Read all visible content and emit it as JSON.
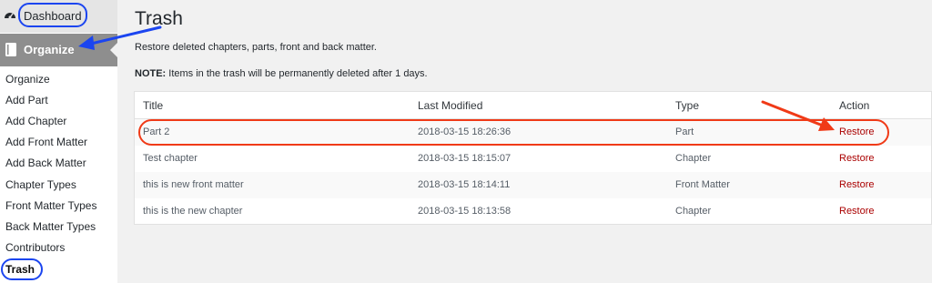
{
  "sidebar": {
    "dashboard_label": "Dashboard",
    "organize_header": "Organize",
    "items": [
      {
        "label": "Organize"
      },
      {
        "label": "Add Part"
      },
      {
        "label": "Add Chapter"
      },
      {
        "label": "Add Front Matter"
      },
      {
        "label": "Add Back Matter"
      },
      {
        "label": "Chapter Types"
      },
      {
        "label": "Front Matter Types"
      },
      {
        "label": "Back Matter Types"
      },
      {
        "label": "Contributors"
      },
      {
        "label": "Trash"
      }
    ]
  },
  "main": {
    "title": "Trash",
    "description": "Restore deleted chapters, parts, front and back matter.",
    "note_label": "NOTE:",
    "note_text": " Items in the trash will be permanently deleted after 1 days.",
    "table": {
      "headers": {
        "title": "Title",
        "modified": "Last Modified",
        "type": "Type",
        "action": "Action"
      },
      "rows": [
        {
          "title": "Part 2",
          "modified": "2018-03-15 18:26:36",
          "type": "Part",
          "action": "Restore"
        },
        {
          "title": "Test chapter",
          "modified": "2018-03-15 18:15:07",
          "type": "Chapter",
          "action": "Restore"
        },
        {
          "title": "this is new front matter",
          "modified": "2018-03-15 18:14:11",
          "type": "Front Matter",
          "action": "Restore"
        },
        {
          "title": "this is the new chapter",
          "modified": "2018-03-15 18:13:58",
          "type": "Chapter",
          "action": "Restore"
        }
      ]
    }
  },
  "colors": {
    "annotation_blue": "#1b45f0",
    "annotation_red": "#f03a17",
    "restore_link": "#aa0000"
  }
}
